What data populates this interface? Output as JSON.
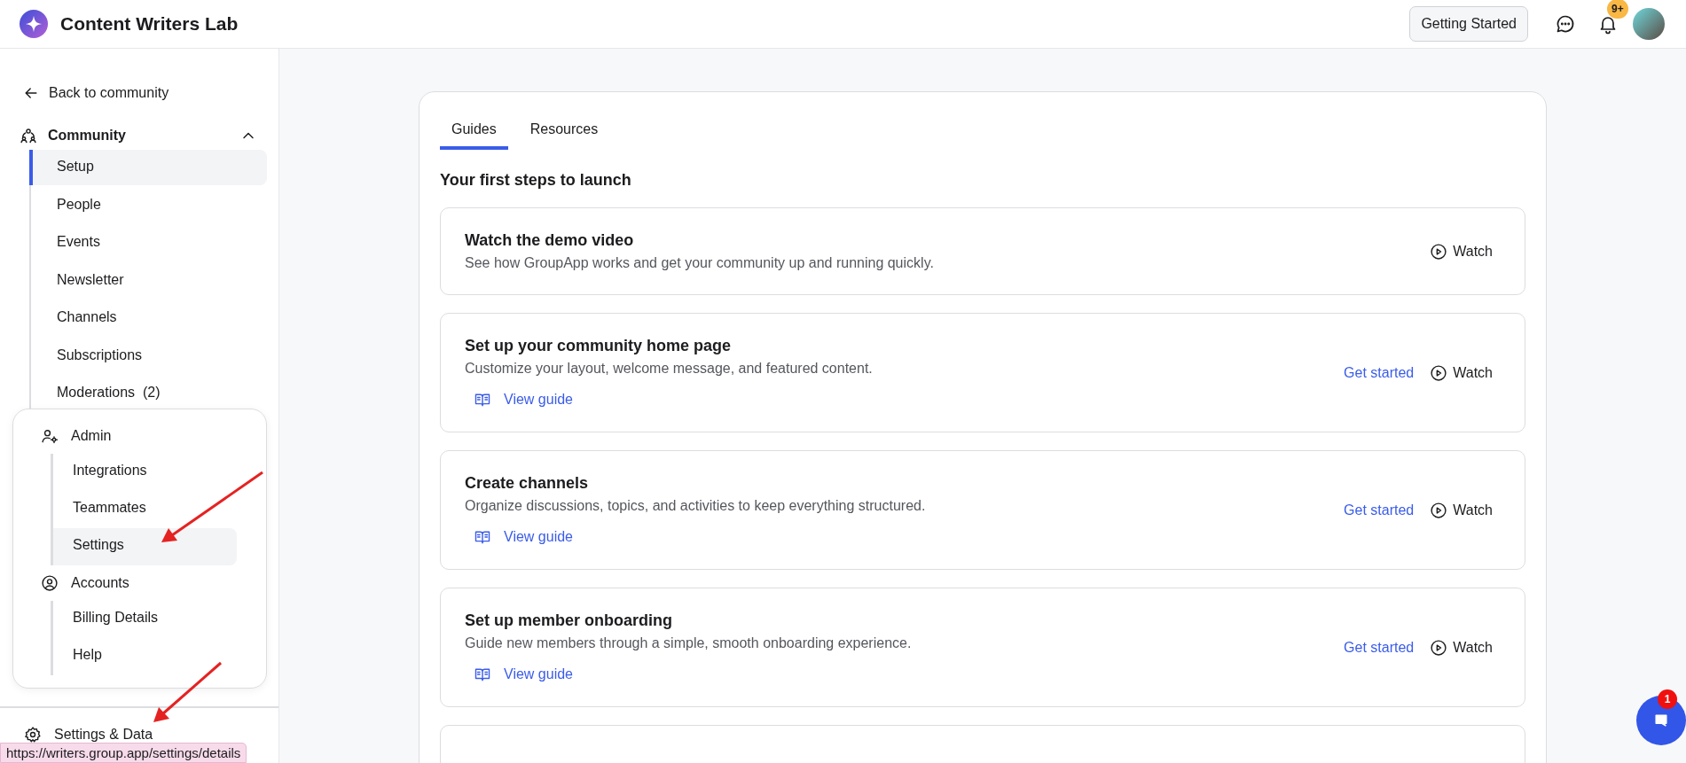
{
  "header": {
    "title": "Content Writers Lab",
    "getting_started": "Getting Started",
    "notification_count": "9+"
  },
  "sidebar": {
    "back": "Back to community",
    "section": {
      "label": "Community",
      "expanded": true,
      "items": [
        {
          "label": "Setup",
          "selected": true
        },
        {
          "label": "People",
          "selected": false
        },
        {
          "label": "Events",
          "selected": false
        },
        {
          "label": "Newsletter",
          "selected": false
        },
        {
          "label": "Channels",
          "selected": false
        },
        {
          "label": "Subscriptions",
          "selected": false
        },
        {
          "label": "Moderations  (2)",
          "selected": false
        }
      ]
    },
    "menu": {
      "groups": [
        {
          "label": "Admin",
          "kind": "admin",
          "items": [
            {
              "label": "Integrations",
              "selected": false
            },
            {
              "label": "Teammates",
              "selected": false
            },
            {
              "label": "Settings",
              "selected": true
            }
          ]
        },
        {
          "label": "Accounts",
          "kind": "accounts",
          "items": [
            {
              "label": "Billing Details",
              "selected": false
            },
            {
              "label": "Help",
              "selected": false
            }
          ]
        }
      ]
    },
    "settings_link": "Settings & Data"
  },
  "link_preview": "https://writers.group.app/settings/details",
  "main": {
    "tabs": [
      {
        "label": "Guides",
        "selected": true
      },
      {
        "label": "Resources",
        "selected": false
      }
    ],
    "heading": "Your first steps to launch",
    "steps": [
      {
        "title": "Watch the demo video",
        "description": "See how GroupApp works and get your community up and running quickly.",
        "watch": "Watch"
      },
      {
        "title": "Set up your community home page",
        "description": "Customize your layout, welcome message, and featured content.",
        "view_guide": "View guide",
        "get_started": "Get started",
        "watch": "Watch"
      },
      {
        "title": "Create channels",
        "description": "Organize discussions, topics, and activities to keep everything structured.",
        "view_guide": "View guide",
        "get_started": "Get started",
        "watch": "Watch"
      },
      {
        "title": "Set up member onboarding",
        "description": "Guide new members through a simple, smooth onboarding experience.",
        "view_guide": "View guide",
        "get_started": "Get started",
        "watch": "Watch"
      }
    ]
  },
  "chat": {
    "badge": "1"
  }
}
